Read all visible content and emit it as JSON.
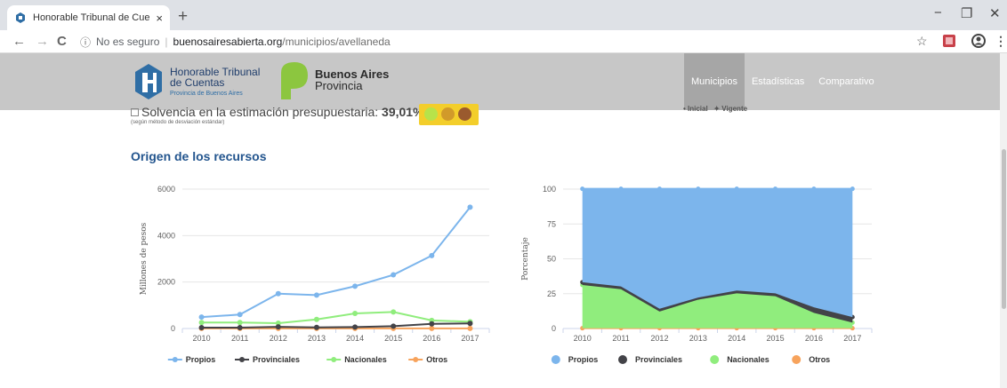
{
  "browser": {
    "tab_title": "Honorable Tribunal de Cuentas d",
    "tab_close": "×",
    "new_tab": "+",
    "nav": {
      "back": "←",
      "forward": "→",
      "reload": "C"
    },
    "security_icon": "ⓘ",
    "security_text": "No es seguro",
    "separator": "|",
    "url_host": "buenosairesabierta.org",
    "url_path": "/municipios/avellaneda",
    "toolbar_icons": {
      "star": "☆",
      "pdf": "⬛",
      "account": "●",
      "menu": "⋮"
    },
    "window_controls": {
      "minimize": "−",
      "maximize": "❐",
      "close": "✕"
    }
  },
  "header": {
    "htc_line1": "Honorable Tribunal",
    "htc_line2": "de Cuentas",
    "htc_line3": "Provincia de Buenos Aires",
    "ba_line1": "Buenos Aires",
    "ba_line2": "Provincia",
    "menu": [
      "Municipios",
      "Estadísticas",
      "Comparativo"
    ],
    "active_menu": "Municipios"
  },
  "solvencia": {
    "label": "Solvencia en la estimación presupuestaria:",
    "value": "39,01%",
    "subtitle": "(según método de desviación estándar)"
  },
  "top_legend": {
    "a": "• Inicial",
    "b": "✦ Vigente"
  },
  "section_title": "Origen de los recursos",
  "colors": {
    "propios": "#7cb5ec",
    "provinciales": "#434348",
    "nacionales": "#90ed7d",
    "otros": "#f7a35c",
    "accent": "#23558e"
  },
  "chart_data": [
    {
      "type": "line",
      "title": "",
      "ylabel": "Millones de pesos",
      "xlabel": "",
      "x": [
        "2010",
        "2011",
        "2012",
        "2013",
        "2014",
        "2015",
        "2016",
        "2017"
      ],
      "ylim": [
        0,
        6000
      ],
      "yticks": [
        "0",
        "2000",
        "4000",
        "6000"
      ],
      "series": [
        {
          "name": "Propios",
          "values": [
            490,
            600,
            1500,
            1440,
            1820,
            2310,
            3140,
            5220
          ]
        },
        {
          "name": "Provinciales",
          "values": [
            40,
            40,
            70,
            50,
            60,
            100,
            200,
            220
          ]
        },
        {
          "name": "Nacionales",
          "values": [
            260,
            260,
            230,
            390,
            650,
            710,
            350,
            290
          ]
        },
        {
          "name": "Otros",
          "values": [
            5,
            5,
            5,
            5,
            5,
            5,
            5,
            5
          ]
        }
      ],
      "legend": "bottom",
      "grid": true
    },
    {
      "type": "area",
      "title": "",
      "ylabel": "Porcentaje",
      "xlabel": "",
      "x": [
        "2010",
        "2011",
        "2012",
        "2013",
        "2014",
        "2015",
        "2016",
        "2017"
      ],
      "ylim": [
        0,
        100
      ],
      "yticks": [
        "0",
        "25",
        "50",
        "75",
        "100"
      ],
      "stacked": "percent",
      "series": [
        {
          "name": "Propios",
          "values": [
            67,
            70,
            86,
            78,
            73,
            75,
            85,
            92
          ]
        },
        {
          "name": "Provinciales",
          "values": [
            2,
            2,
            2,
            1.5,
            2,
            2,
            4,
            4
          ]
        },
        {
          "name": "Nacionales",
          "values": [
            31,
            28,
            12,
            20.5,
            25,
            23,
            11,
            4
          ]
        },
        {
          "name": "Otros",
          "values": [
            0.2,
            0.2,
            0.2,
            0.2,
            0.2,
            0.2,
            0.2,
            0.2
          ]
        }
      ],
      "legend": "bottom",
      "grid": true
    }
  ]
}
